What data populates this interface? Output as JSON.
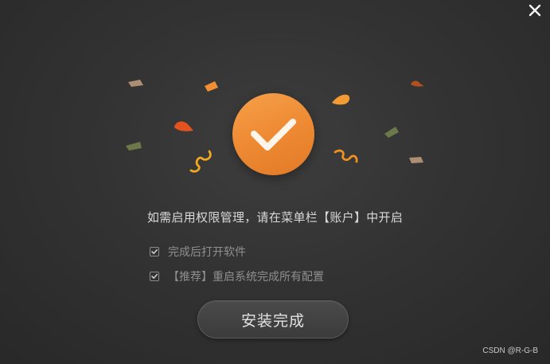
{
  "dialog": {
    "close_icon": "close-icon",
    "success_icon": "checkmark-icon",
    "message": "如需启用权限管理，请在菜单栏【账户】中开启",
    "options": [
      {
        "label": "完成后打开软件",
        "checked": true
      },
      {
        "label": "【推荐】重启系统完成所有配置",
        "checked": true
      }
    ],
    "finish_button_label": "安装完成",
    "watermark": "CSDN @R-G-B"
  },
  "colors": {
    "accent": "#ee8a33",
    "background": "#333333"
  }
}
